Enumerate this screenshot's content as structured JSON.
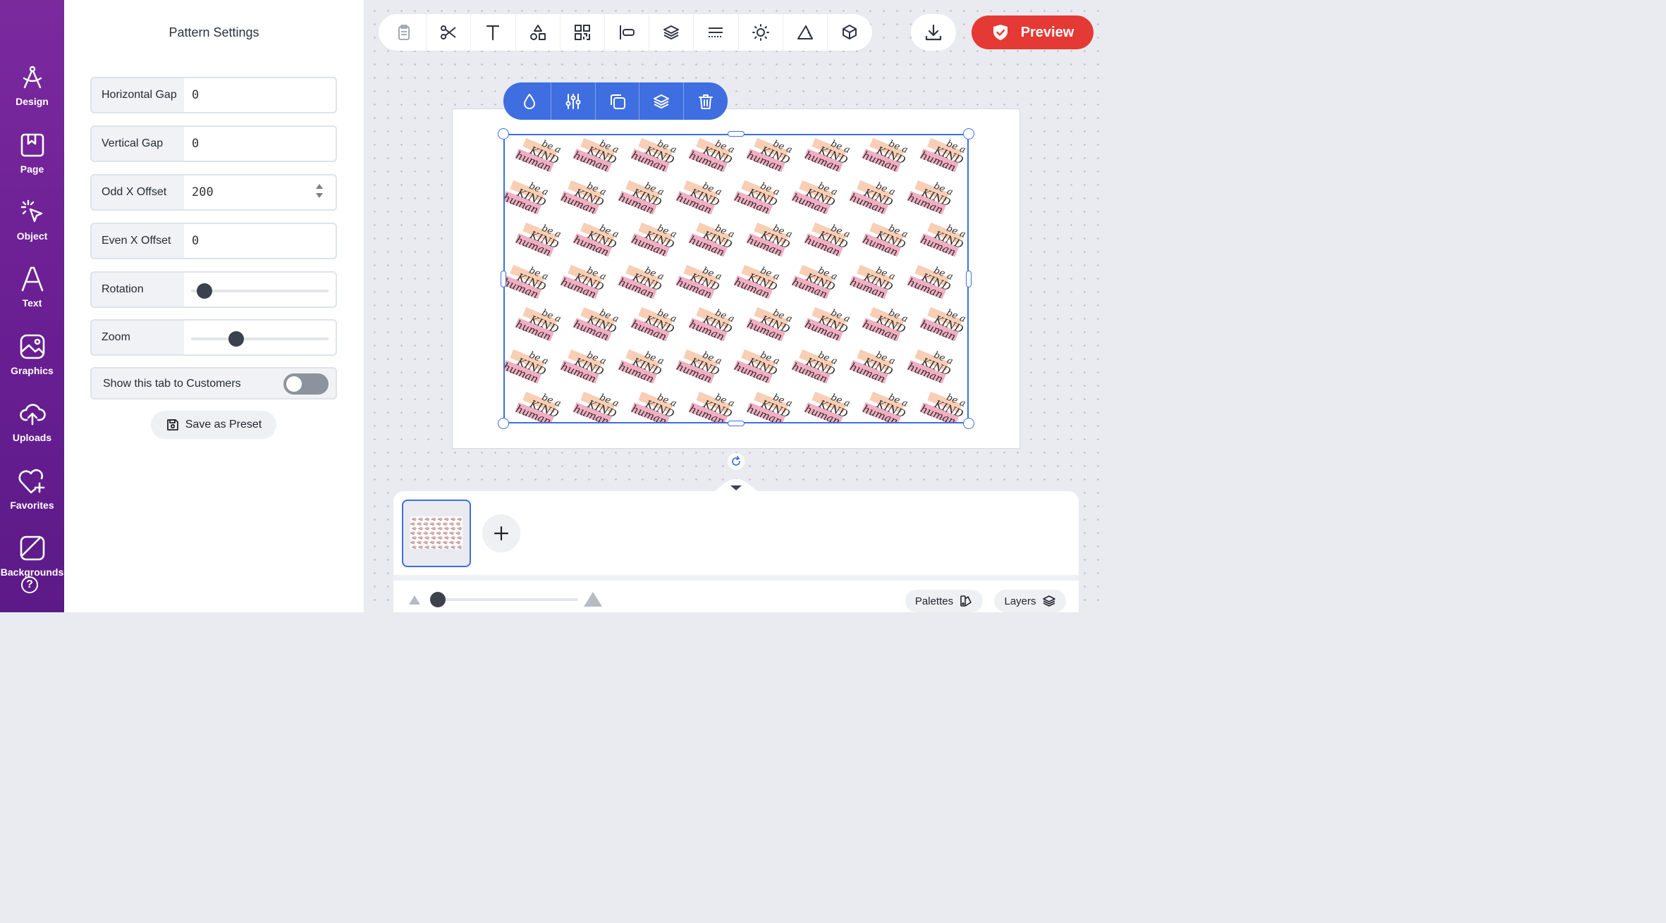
{
  "sidebar": {
    "items": [
      {
        "label": "Design",
        "icon": "compass-icon"
      },
      {
        "label": "Page",
        "icon": "bookmark-page-icon"
      },
      {
        "label": "Object",
        "icon": "pointer-click-icon"
      },
      {
        "label": "Text",
        "icon": "text-a-icon"
      },
      {
        "label": "Graphics",
        "icon": "image-icon"
      },
      {
        "label": "Uploads",
        "icon": "cloud-upload-icon"
      },
      {
        "label": "Favorites",
        "icon": "heart-plus-icon"
      },
      {
        "label": "Backgrounds",
        "icon": "background-icon"
      }
    ],
    "help_glyph": "?"
  },
  "panel": {
    "title": "Pattern Settings",
    "fields": {
      "horizontal_gap": {
        "label": "Horizontal Gap",
        "value": "0"
      },
      "vertical_gap": {
        "label": "Vertical Gap",
        "value": "0"
      },
      "odd_x_offset": {
        "label": "Odd X Offset",
        "value": "200"
      },
      "even_x_offset": {
        "label": "Even X Offset",
        "value": "0"
      }
    },
    "rotation": {
      "label": "Rotation",
      "level": 0.1
    },
    "zoom": {
      "label": "Zoom",
      "level": 0.33
    },
    "show_tab": {
      "label": "Show this tab to Customers",
      "enabled": false
    },
    "save_preset": "Save as Preset"
  },
  "toolbar": {
    "tools": [
      "clipboard-icon",
      "scissors-icon",
      "text-icon",
      "shapes-icon",
      "qr-code-icon",
      "align-icon",
      "layers-icon",
      "grid-lines-icon",
      "brightness-icon",
      "triangle-ruler-icon",
      "3d-box-icon"
    ]
  },
  "actions": {
    "preview_label": "Preview"
  },
  "selection_toolbar": {
    "tools": [
      "color-drop-icon",
      "adjust-sliders-icon",
      "duplicate-icon",
      "layers-icon",
      "trash-icon"
    ]
  },
  "pattern": {
    "line1": "be a",
    "line2": "KIND",
    "line3": "human"
  },
  "drawer": {
    "add_page_glyph": "+",
    "palettes_label": "Palettes",
    "layers_label": "Layers",
    "zoom_level": 0.05
  },
  "colors": {
    "rail_purple": "#6a1f93",
    "accent_blue": "#3f6ee0",
    "preview_red": "#e53935",
    "pattern_peach": "#f7c6a8",
    "pattern_pink": "#f0a0b8"
  }
}
